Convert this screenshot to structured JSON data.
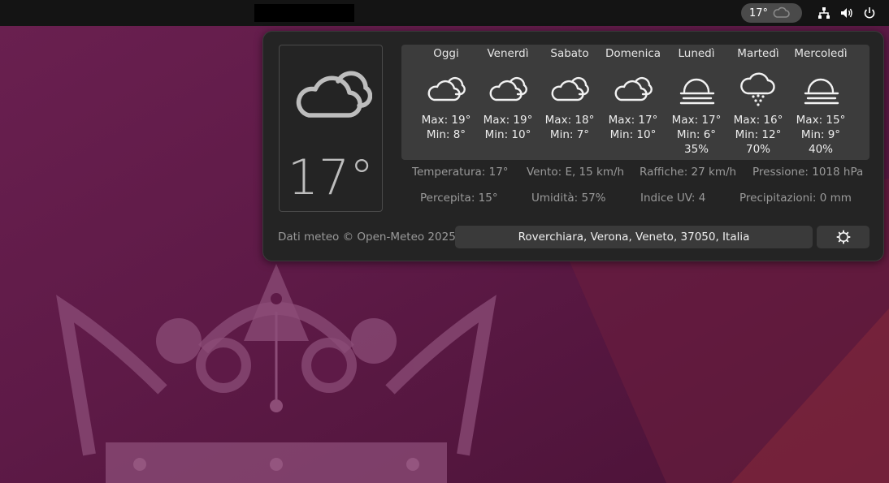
{
  "topbar": {
    "indicator_temp": "17°",
    "indicator_icon": "cloud-icon",
    "tray_icons": [
      "network-icon",
      "volume-icon",
      "power-icon"
    ]
  },
  "current": {
    "temperature": "17°",
    "icon": "cloud-icon"
  },
  "forecast": [
    {
      "day": "Oggi",
      "icon": "cloudy-icon",
      "max": "Max: 19°",
      "min": "Min: 8°",
      "precip": ""
    },
    {
      "day": "Venerdì",
      "icon": "cloudy-icon",
      "max": "Max: 19°",
      "min": "Min: 10°",
      "precip": ""
    },
    {
      "day": "Sabato",
      "icon": "cloudy-icon",
      "max": "Max: 18°",
      "min": "Min: 7°",
      "precip": ""
    },
    {
      "day": "Domenica",
      "icon": "cloudy-icon",
      "max": "Max: 17°",
      "min": "Min: 10°",
      "precip": ""
    },
    {
      "day": "Lunedì",
      "icon": "fog-icon",
      "max": "Max: 17°",
      "min": "Min: 6°",
      "precip": "35%"
    },
    {
      "day": "Martedì",
      "icon": "rain-icon",
      "max": "Max: 16°",
      "min": "Min: 12°",
      "precip": "70%"
    },
    {
      "day": "Mercoledì",
      "icon": "fog-icon",
      "max": "Max: 15°",
      "min": "Min: 9°",
      "precip": "40%"
    }
  ],
  "details": {
    "temperature": "Temperatura: 17°",
    "wind": "Vento: E, 15 km/h",
    "gusts": "Raffiche: 27 km/h",
    "pressure": "Pressione: 1018 hPa",
    "feels_like": "Percepita: 15°",
    "humidity": "Umidità: 57%",
    "uv": "Indice UV: 4",
    "precipitation": "Precipitazioni: 0 mm"
  },
  "footer": {
    "credits": "Dati meteo © Open-Meteo 2025",
    "location": "Roverchiara, Verona, Veneto, 37050, Italia",
    "settings_icon": "gear-icon"
  },
  "colors": {
    "panel_bg": "#242424",
    "forecast_bg": "#3c3c3c",
    "wallpaper": "#5a1a44"
  }
}
